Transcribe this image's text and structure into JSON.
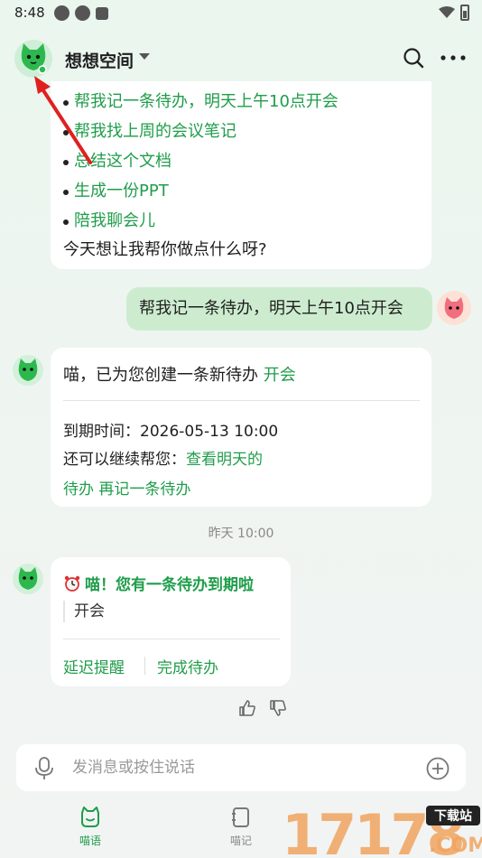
{
  "status_bar": {
    "time": "8:48"
  },
  "header": {
    "title": "想想空间"
  },
  "suggestions": {
    "items": [
      "帮我记一条待办，明天上午10点开会",
      "帮我找上周的会议笔记",
      "总结这个文档",
      "生成一份PPT",
      "陪我聊会儿"
    ],
    "ask": "今天想让我帮你做点什么呀?"
  },
  "user_message": {
    "text": "帮我记一条待办，明天上午10点开会"
  },
  "reply": {
    "prefix": "喵，已为您创建一条新待办 ",
    "link": "开会",
    "due": "到期时间：2026-05-13 10:00",
    "more_prefix": "还可以继续帮您：",
    "more_link1": "查看明天的待办",
    "more_link2": "再记一条待办"
  },
  "timestamp": "昨天 10:00",
  "reminder": {
    "title": "喵！您有一条待办到期啦",
    "item": "开会",
    "delay_label": "延迟提醒",
    "done_label": "完成待办"
  },
  "input": {
    "placeholder": "发消息或按住说话"
  },
  "tabs": [
    {
      "label": "喵语"
    },
    {
      "label": "喵记"
    }
  ],
  "watermark": {
    "text": "17178",
    "tag": "下载站",
    "domain": ".COM"
  },
  "colors": {
    "accent": "#1f9d4a",
    "user_bubble": "#cdeccf",
    "arrow": "#e02020"
  }
}
